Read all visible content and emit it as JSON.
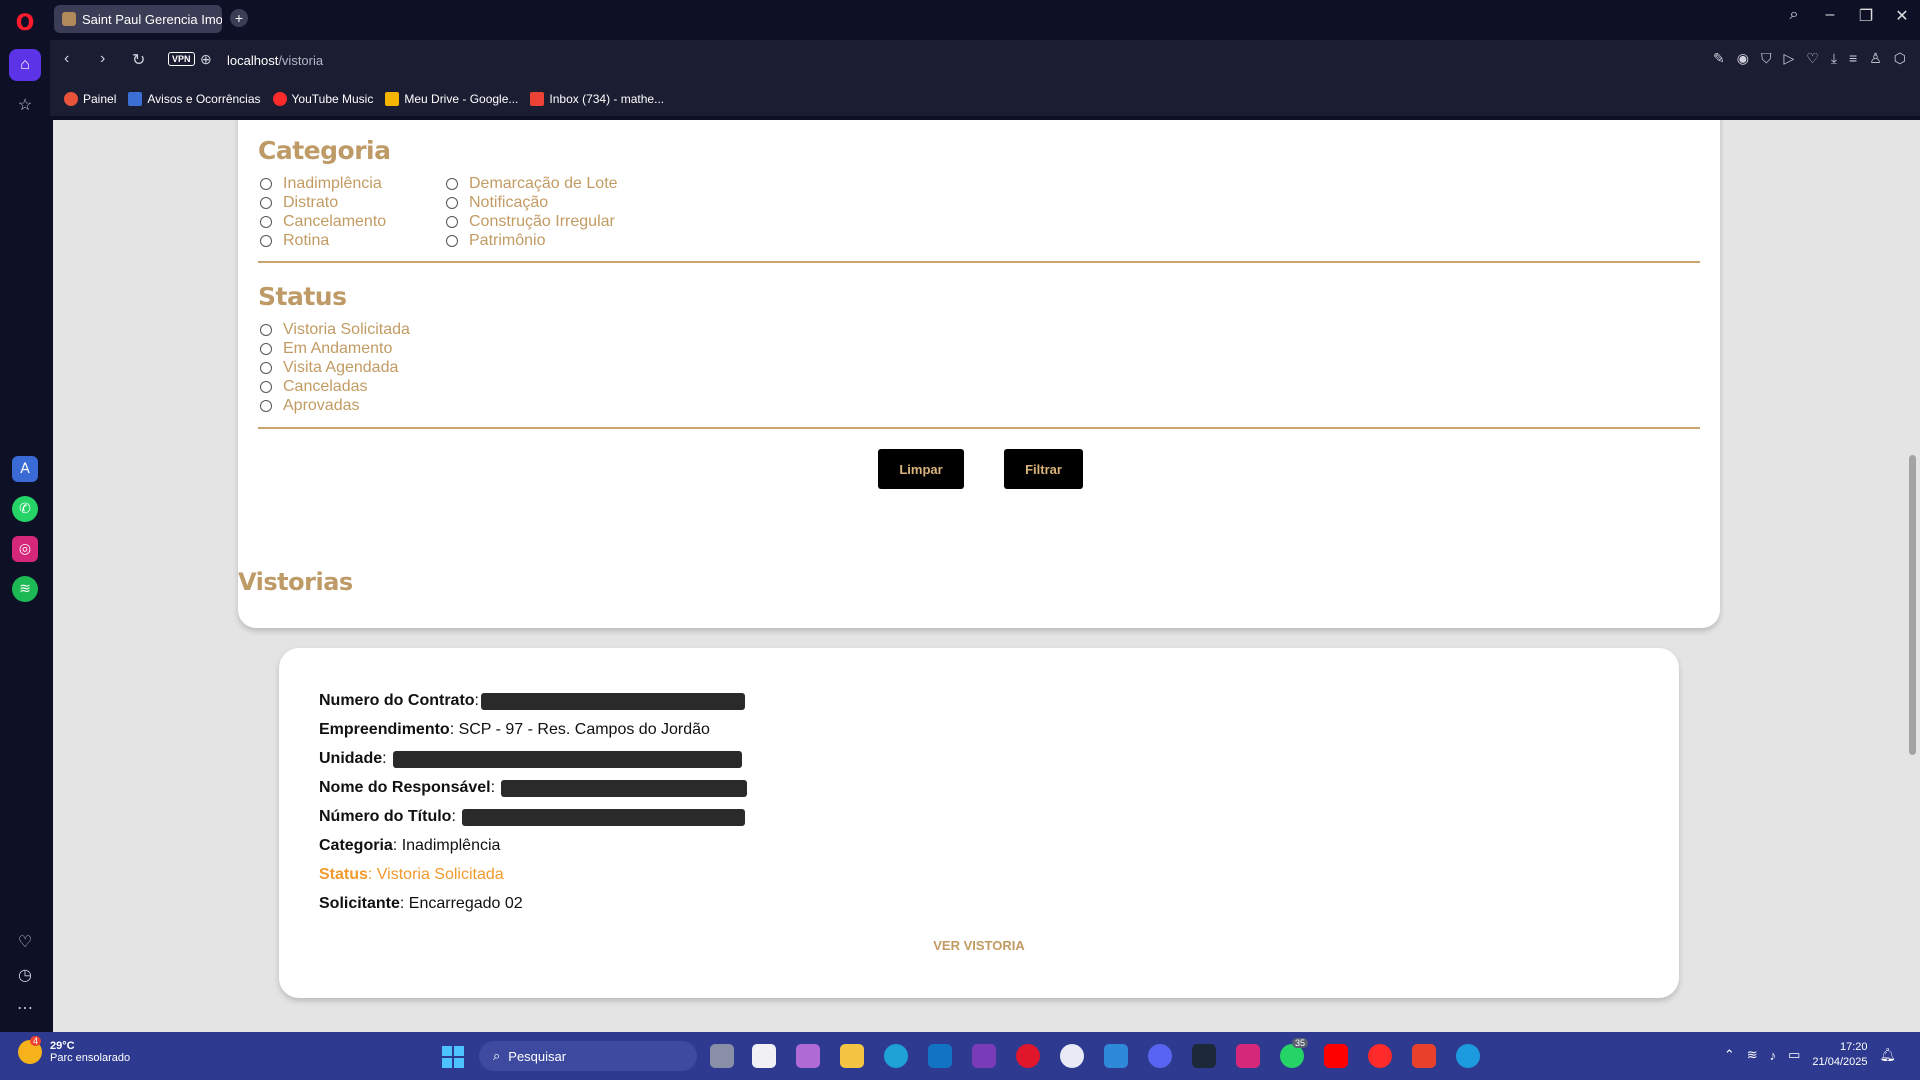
{
  "browser": {
    "tab_title": "Saint Paul Gerencia Imob",
    "url_host": "localhost",
    "url_path": "/vistoria",
    "vpn_label": "VPN",
    "bookmarks": [
      {
        "label": "Painel",
        "color": "#e8533a"
      },
      {
        "label": "Avisos e Ocorrências",
        "color": "#3b6fd6"
      },
      {
        "label": "YouTube Music",
        "color": "#ff2a2a"
      },
      {
        "label": "Meu Drive - Google...",
        "color": "#f4b400"
      },
      {
        "label": "Inbox (734) - mathe...",
        "color": "#ea4335"
      }
    ]
  },
  "filters": {
    "categoria_title": "Categoria",
    "categoria_col1": [
      "Inadimplência",
      "Distrato",
      "Cancelamento",
      "Rotina"
    ],
    "categoria_col2": [
      "Demarcação de Lote",
      "Notificação",
      "Construção Irregular",
      "Patrimônio"
    ],
    "status_title": "Status",
    "status_options": [
      "Vistoria Solicitada",
      "Em Andamento",
      "Visita Agendada",
      "Canceladas",
      "Aprovadas"
    ],
    "clear_label": "Limpar",
    "filter_label": "Filtrar"
  },
  "vistorias": {
    "heading": "Vistorias",
    "card": {
      "contrato_label": "Numero do Contrato",
      "empreendimento_label": "Empreendimento",
      "empreendimento_value": ": SCP - 97 - Res. Campos do Jordão",
      "unidade_label": "Unidade",
      "responsavel_label": "Nome do Responsável",
      "titulo_label": "Número do Título",
      "categoria_label": "Categoria",
      "categoria_value": ": Inadimplência",
      "status_label": "Status",
      "status_value": ": Vistoria Solicitada",
      "solicitante_label": "Solicitante",
      "solicitante_value": ": Encarregado 02",
      "ver_label": "VER VISTORIA"
    }
  },
  "taskbar": {
    "weather_temp": "29°C",
    "weather_desc": "Parc ensolarado",
    "weather_badge": "4",
    "search_placeholder": "Pesquisar",
    "whatsapp_badge": "35",
    "time": "17:20",
    "date": "21/04/2025"
  },
  "colors": {
    "accent_gold": "#bd9a66",
    "status_orange": "#f29a2e",
    "opera_active": "#5d33e8"
  }
}
